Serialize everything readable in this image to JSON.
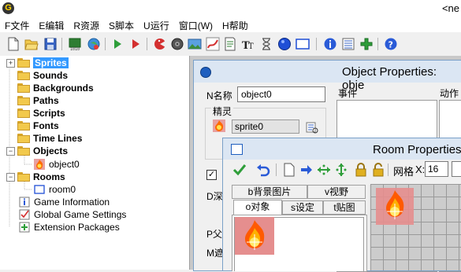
{
  "window": {
    "title": "<ne"
  },
  "menu": [
    "F文件",
    "E编辑",
    "R资源",
    "S脚本",
    "U运行",
    "窗口(W)",
    "H帮助"
  ],
  "tree": {
    "folders": [
      "Sprites",
      "Sounds",
      "Backgrounds",
      "Paths",
      "Scripts",
      "Fonts",
      "Time Lines",
      "Objects",
      "Rooms"
    ],
    "objects_child": "object0",
    "rooms_child": "room0",
    "extras": [
      "Game Information",
      "Global Game Settings",
      "Extension Packages"
    ]
  },
  "object_props": {
    "title": "Object Properties: obje",
    "name_label": "N名称",
    "name_value": "object0",
    "sprite_group": "精灵",
    "sprite_value": "sprite0",
    "events_label": "事件",
    "actions_label": "动作",
    "partial_labels": [
      "D深",
      "P父",
      "M遮"
    ]
  },
  "room_props": {
    "title": "Room Properties",
    "grid_label": "网格",
    "grid_x_label": "X:",
    "grid_x_value": "16",
    "tabs_row1": [
      "b背景图片",
      "v视野"
    ],
    "tabs_row2": [
      "o对象",
      "s设定",
      "t贴图"
    ]
  }
}
